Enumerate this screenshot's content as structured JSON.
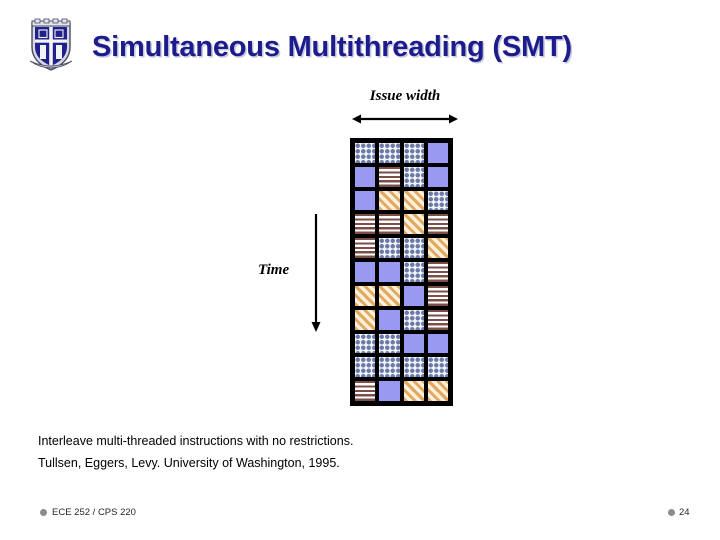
{
  "slide": {
    "title": "Simultaneous Multithreading (SMT)",
    "logo_name": "duke-university-crest",
    "title_color": "#1c1c8c"
  },
  "axes": {
    "horizontal": {
      "label": "Issue width",
      "arrow": "double-headed-horizontal-arrow"
    },
    "vertical": {
      "label": "Time",
      "arrow": "downward-arrow"
    }
  },
  "diagram": {
    "name": "smt-issue-slot-grid",
    "columns": 4,
    "rows": 11,
    "legend": {
      "solid": "#9999f2",
      "diamond": "#6c7ba8",
      "hstripe": "#7a4f4a",
      "diagonal": "#e0a860"
    },
    "cells": [
      [
        "diamond",
        "diamond",
        "diamond",
        "solid"
      ],
      [
        "solid",
        "hstripe",
        "diamond",
        "solid"
      ],
      [
        "solid",
        "diagonal",
        "diagonal",
        "diamond"
      ],
      [
        "hstripe",
        "hstripe",
        "diagonal",
        "hstripe"
      ],
      [
        "hstripe",
        "diamond",
        "diamond",
        "diagonal"
      ],
      [
        "solid",
        "solid",
        "diamond",
        "hstripe"
      ],
      [
        "diagonal",
        "diagonal",
        "solid",
        "hstripe"
      ],
      [
        "diagonal",
        "solid",
        "diamond",
        "hstripe"
      ],
      [
        "diamond",
        "diamond",
        "solid",
        "solid"
      ],
      [
        "diamond",
        "diamond",
        "diamond",
        "diamond"
      ],
      [
        "hstripe",
        "solid",
        "diagonal",
        "diagonal"
      ]
    ]
  },
  "caption": {
    "line1": "Interleave multi-threaded instructions with no restrictions.",
    "line2": "Tullsen, Eggers, Levy. University of Washington, 1995."
  },
  "footer": {
    "course": "ECE 252 / CPS 220",
    "page_number": "24"
  }
}
